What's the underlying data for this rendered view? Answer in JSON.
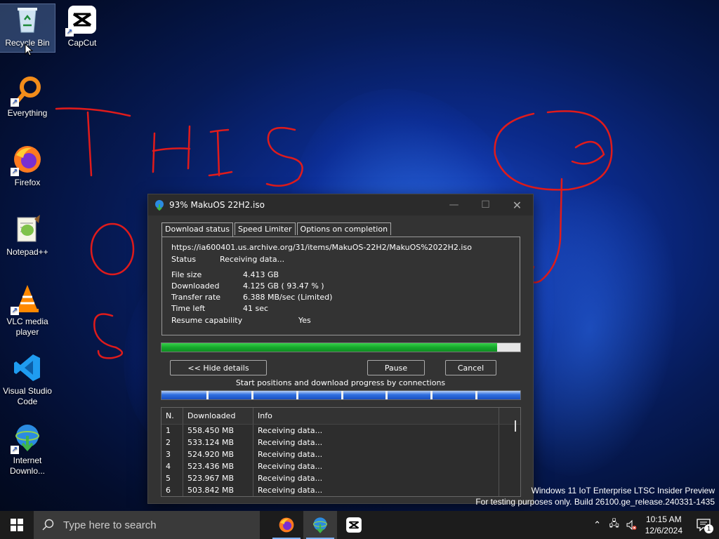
{
  "desktop": {
    "icons": [
      {
        "label": "Recycle Bin",
        "icon": "recycle-bin-icon"
      },
      {
        "label": "CapCut",
        "icon": "capcut-icon"
      },
      {
        "label": "Everything",
        "icon": "everything-search-icon"
      },
      {
        "label": "Firefox",
        "icon": "firefox-icon"
      },
      {
        "label": "Notepad++",
        "icon": "notepadpp-icon"
      },
      {
        "label": "VLC media player",
        "icon": "vlc-icon"
      },
      {
        "label": "Visual Studio Code",
        "icon": "vscode-icon"
      },
      {
        "label": "Internet Downlo...",
        "icon": "idm-icon"
      }
    ],
    "watermark_line1": "Windows 11 IoT Enterprise LTSC Insider Preview",
    "watermark_line2": "For testing purposes only. Build 26100.ge_release.240331-1435",
    "drawing_color": "#e01b1b"
  },
  "dialog": {
    "title": "93% MakuOS 22H2.iso",
    "tabs": [
      "Download status",
      "Speed Limiter",
      "Options on completion"
    ],
    "url": "https://ia600401.us.archive.org/31/items/MakuOS-22H2/MakuOS%2022H2.iso",
    "status_label": "Status",
    "status_value": "Receiving data...",
    "file_size_label": "File size",
    "file_size_value": "4.413  GB",
    "downloaded_label": "Downloaded",
    "downloaded_value": "4.125  GB  ( 93.47 % )",
    "transfer_rate_label": "Transfer rate",
    "transfer_rate_value": "6.388  MB/sec  (Limited)",
    "time_left_label": "Time left",
    "time_left_value": "41 sec",
    "resume_label": "Resume capability",
    "resume_value": "Yes",
    "progress_fraction": 0.9347,
    "progress_color": "#1db233",
    "hide_details_label": "<< Hide details",
    "pause_label": "Pause",
    "cancel_label": "Cancel",
    "connections_label": "Start positions and download progress by connections",
    "columns": [
      "N.",
      "Downloaded",
      "Info"
    ],
    "connections": [
      {
        "n": "1",
        "downloaded": "558.450  MB",
        "info": "Receiving data..."
      },
      {
        "n": "2",
        "downloaded": "533.124  MB",
        "info": "Receiving data..."
      },
      {
        "n": "3",
        "downloaded": "524.920  MB",
        "info": "Receiving data..."
      },
      {
        "n": "4",
        "downloaded": "523.436  MB",
        "info": "Receiving data..."
      },
      {
        "n": "5",
        "downloaded": "523.967  MB",
        "info": "Receiving data..."
      },
      {
        "n": "6",
        "downloaded": "503.842  MB",
        "info": "Receiving data..."
      }
    ]
  },
  "taskbar": {
    "search_placeholder": "Type here to search",
    "apps": [
      "firefox-icon",
      "idm-icon",
      "capcut-icon"
    ],
    "time": "10:15 AM",
    "date": "12/6/2024",
    "notification_count": "1"
  }
}
